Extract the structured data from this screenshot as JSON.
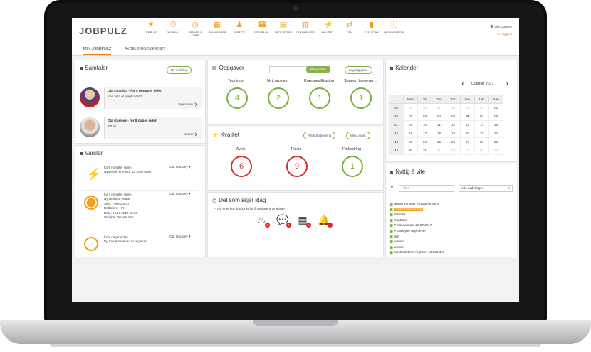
{
  "app": {
    "logo": "JOBPULZ"
  },
  "nav": [
    {
      "label": "JOBPULZ",
      "icon": "sun-icon"
    },
    {
      "label": "JOURNAL",
      "icon": "journal-icon"
    },
    {
      "label": "FRAVÆR & TIMER",
      "icon": "clock-icon"
    },
    {
      "label": "PLANLEGGER",
      "icon": "calendar-icon"
    },
    {
      "label": "ANSATTE",
      "icon": "people-icon"
    },
    {
      "label": "FEEDBACK",
      "icon": "feedback-icon"
    },
    {
      "label": "PROSJEKTER",
      "icon": "projects-icon"
    },
    {
      "label": "DOKUMENTER",
      "icon": "documents-icon"
    },
    {
      "label": "KVALITET",
      "icon": "bolt-icon"
    },
    {
      "label": "CRM",
      "icon": "handshake-icon"
    },
    {
      "label": "STATISTIKK",
      "icon": "stats-icon"
    },
    {
      "label": "ORGANISASJON",
      "icon": "info-icon"
    }
  ],
  "user": {
    "name": "Ola Godoey",
    "logout": "Logg Ut"
  },
  "tabs": [
    "MIN JOBBPULZ",
    "AVDELINGSOVERSIKT"
  ],
  "samtaler": {
    "title": "Samtaler",
    "new_button": "Ny melding",
    "messages": [
      {
        "name": "Ola Chamba - for 5 minutter siden",
        "text": "Kan vi ta et kjapt møte?",
        "reply": "Ingen svar"
      },
      {
        "name": "Ola Godoey - for 8 dager siden",
        "text": "Titt tei",
        "reply": "1 svar"
      }
    ]
  },
  "varsler": {
    "title": "Varsler",
    "items": [
      {
        "lines": [
          "for 6 minutter siden",
          "Nytt avvik er meldt: 11 Sted Avvik"
        ],
        "who": "Ola Godoey"
      },
      {
        "lines": [
          "for 7 minutter siden",
          "Ny aktivitet - Møte",
          "Sted: Fellesrom 1",
          "Deltakere: HR",
          "Dato: 06.10.2017 15:30",
          "Varighet: 30 Minutter"
        ],
        "who": "Ola Godoey"
      },
      {
        "lines": [
          "for 8 dager siden",
          "Ny fraværssøknad er registrert"
        ],
        "who": "Ola Godoey"
      }
    ]
  },
  "oppgaver": {
    "title": "Oppgaver",
    "report_button": "Rapportert",
    "add_button": "Lag oppgave",
    "items": [
      {
        "label": "Tegninger",
        "value": "4"
      },
      {
        "label": "Nytt prosjekt",
        "value": "2"
      },
      {
        "label": "Kravspesifikasjon",
        "value": "1"
      },
      {
        "label": "Support barnever...",
        "value": "1"
      }
    ]
  },
  "kvalitet": {
    "title": "Kvalitet",
    "risk_button": "Risikoforbedring",
    "report_button": "Meld avvik",
    "items": [
      {
        "label": "Avvik",
        "value": "6"
      },
      {
        "label": "Risiko",
        "value": "9"
      },
      {
        "label": "Forbedring",
        "value": "1"
      }
    ]
  },
  "idag": {
    "title": "Det som skjer idag",
    "note": "Nå er et bra tidspunkt for å registrere timelister",
    "icons": [
      {
        "name": "birthday-cake-icon",
        "badge": "1"
      },
      {
        "name": "chat-icon",
        "badge": "2"
      },
      {
        "name": "calendar-icon",
        "badge": "1"
      },
      {
        "name": "bell-icon",
        "badge": "1"
      }
    ]
  },
  "kalender": {
    "title": "Kalender",
    "month": "October 2017",
    "days": [
      "Man",
      "Tir",
      "Ons",
      "Tor",
      "Fre",
      "Lør",
      "Søn"
    ],
    "weeks": [
      {
        "wk": "39",
        "days": [
          "25",
          "26",
          "27",
          "28",
          "29",
          "30",
          "01"
        ]
      },
      {
        "wk": "40",
        "days": [
          "02",
          "03",
          "04",
          "05",
          "06",
          "07",
          "08"
        ]
      },
      {
        "wk": "41",
        "days": [
          "09",
          "10",
          "11",
          "12",
          "13",
          "14",
          "15"
        ]
      },
      {
        "wk": "42",
        "days": [
          "16",
          "17",
          "18",
          "19",
          "20",
          "21",
          "22"
        ]
      },
      {
        "wk": "43",
        "days": [
          "23",
          "24",
          "25",
          "26",
          "27",
          "28",
          "29"
        ]
      },
      {
        "wk": "44",
        "days": [
          "30",
          "31",
          "01",
          "02",
          "03",
          "04",
          "05"
        ]
      }
    ]
  },
  "nyttig": {
    "title": "Nyttig å vite",
    "filter_placeholder": "Filter",
    "department": "Alle avdelinger",
    "items": [
      {
        "text": "ansatt kommer fortsatt for sent",
        "highlight": false
      },
      {
        "text": "Sikkerhetsmanual",
        "highlight": true
      },
      {
        "text": "Instruks",
        "highlight": false
      },
      {
        "text": "Kontrakt",
        "highlight": false
      },
      {
        "text": "Personalmøte 23.07.2017",
        "highlight": false
      },
      {
        "text": "Prosedyrer uriproever",
        "highlight": false
      },
      {
        "text": "test",
        "highlight": false
      },
      {
        "text": "werwer",
        "highlight": false
      },
      {
        "text": "werwer",
        "highlight": false
      },
      {
        "text": "sambruk bmw registert 12.2016bm",
        "highlight": false
      }
    ]
  },
  "colors": {
    "accent": "#f0a020",
    "green": "#77b040",
    "red": "#d43030",
    "highlight": "#f39c1f"
  }
}
